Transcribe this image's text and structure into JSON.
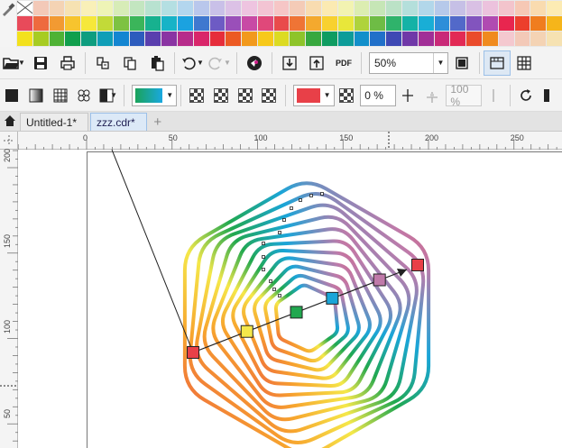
{
  "palette": {
    "colors": [
      "#f4c8cf",
      "#f3c9b8",
      "#f4d3b4",
      "#f6e2b2",
      "#f9f0b8",
      "#eef4b6",
      "#d7ecb7",
      "#c3e6c0",
      "#b8e2d0",
      "#b4dfe2",
      "#b3d6ee",
      "#b9c7ec",
      "#c9c0e8",
      "#dcc1e6",
      "#eec4e0",
      "#f3c4d3",
      "#f6c6c6",
      "#f4cbb7",
      "#f8dcb0",
      "#fbeab2",
      "#f2f3b1",
      "#dcedb1",
      "#c6e6b6",
      "#bbe2c6",
      "#b4dfdb",
      "#b2d7ea",
      "#b6c9ea",
      "#c6c0e6",
      "#d9c0e4",
      "#ecc2dd",
      "#f3c4cc",
      "#f6c8b5",
      "#f9dbaf",
      "#fcebb3",
      "#e84a5a",
      "#ee6a3e",
      "#f29a32",
      "#f7c42e",
      "#f6e83a",
      "#c2da38",
      "#7dc242",
      "#3bb55a",
      "#17b18f",
      "#17b3c7",
      "#1ba2e0",
      "#3f78cf",
      "#6d5bc4",
      "#9a4fb9",
      "#c84aa5",
      "#e0487a",
      "#e94b4b",
      "#ef7435",
      "#f4a92e",
      "#f8d12f",
      "#e8e73a",
      "#afd33c",
      "#6ebc45",
      "#2fb36b",
      "#14b2a6",
      "#19aed6",
      "#2d8ed9",
      "#5269c9",
      "#8254be",
      "#b04bb1",
      "#e8264f",
      "#ec3f2c",
      "#f07d1e",
      "#f6b51a",
      "#f3e11d",
      "#a7cc22",
      "#4fb235",
      "#119f4d",
      "#0e9d7f",
      "#0f9eb7",
      "#1486d1",
      "#2d5cbd",
      "#5a3fae",
      "#8a34a3",
      "#b72c8b",
      "#d9266a",
      "#e62d3b",
      "#ec5a23",
      "#f2991c",
      "#f7c91b",
      "#dcdb22",
      "#8ec42a",
      "#38a83f",
      "#0f9c61",
      "#0d9c99",
      "#128fca",
      "#2170c9",
      "#3f49b4",
      "#7038a8",
      "#a12f97",
      "#c92a78",
      "#e22a55",
      "#ea4b2b",
      "#f08a1e"
    ]
  },
  "std_toolbar": {
    "zoom": "50%",
    "icons": [
      "open-icon",
      "save-icon",
      "print-icon",
      "cut-icon",
      "copy-icon",
      "paste-icon",
      "undo-icon",
      "redo-icon",
      "search-content-icon",
      "import-icon",
      "export-icon",
      "pdf-icon"
    ],
    "pdf_label": "PDF",
    "zoom_arrow": "▼"
  },
  "prop_toolbar": {
    "transparency_value": "0 %",
    "merge_value": "100 %",
    "fill_color": "#e84048"
  },
  "tabs": {
    "doc1": "Untitled-1*",
    "doc2": "zzz.cdr*",
    "add": "+"
  },
  "ruler_top": {
    "labels": [
      "0",
      "50",
      "100",
      "150",
      "200",
      "250"
    ],
    "values": [
      0,
      50,
      100,
      150,
      200,
      250
    ]
  },
  "ruler_left": {
    "labels": [
      "200",
      "150",
      "100",
      "50"
    ],
    "values": [
      200,
      150,
      100,
      50
    ]
  },
  "drawing": {
    "colors": [
      "#e84048",
      "#f7a52e",
      "#f5e84a",
      "#21a84f",
      "#1aa5d8",
      "#c07aa9",
      "#e84048"
    ],
    "nodes": [
      {
        "color": "#e84048",
        "t": 0
      },
      {
        "color": "#f5e84a",
        "t": 0.24
      },
      {
        "color": "#21a84f",
        "t": 0.46
      },
      {
        "color": "#1aa5d8",
        "t": 0.62
      },
      {
        "color": "#c07aa9",
        "t": 0.83
      },
      {
        "color": "#e84048",
        "t": 1
      }
    ]
  }
}
